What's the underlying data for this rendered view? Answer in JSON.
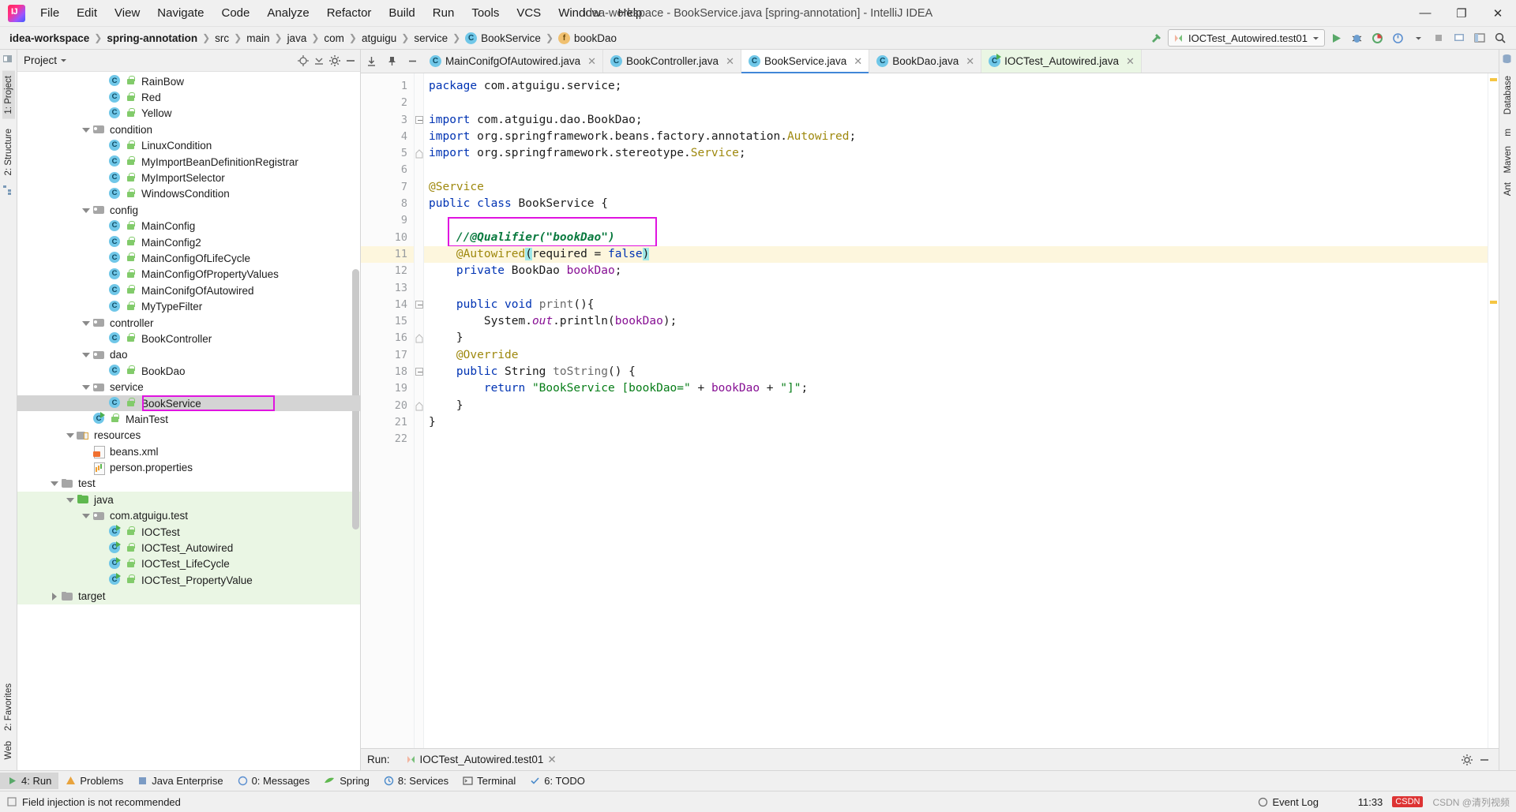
{
  "window": {
    "title": "idea-workspace - BookService.java [spring-annotation] - IntelliJ IDEA",
    "minimize": "—",
    "maximize": "❐",
    "close": "✕"
  },
  "menu": [
    {
      "label": "File"
    },
    {
      "label": "Edit"
    },
    {
      "label": "View"
    },
    {
      "label": "Navigate"
    },
    {
      "label": "Code"
    },
    {
      "label": "Analyze"
    },
    {
      "label": "Refactor"
    },
    {
      "label": "Build"
    },
    {
      "label": "Run"
    },
    {
      "label": "Tools"
    },
    {
      "label": "VCS"
    },
    {
      "label": "Window"
    },
    {
      "label": "Help"
    }
  ],
  "breadcrumb": [
    {
      "label": "idea-workspace",
      "bold": true
    },
    {
      "label": "spring-annotation",
      "bold": true
    },
    {
      "label": "src"
    },
    {
      "label": "main"
    },
    {
      "label": "java"
    },
    {
      "label": "com"
    },
    {
      "label": "atguigu"
    },
    {
      "label": "service"
    },
    {
      "label": "BookService",
      "icon": "class-icon"
    },
    {
      "label": "bookDao",
      "icon": "field-icon"
    }
  ],
  "toolbar": {
    "run_config": "IOCTest_Autowired.test01",
    "buttons": [
      "run-button",
      "debug-button",
      "coverage-button",
      "profile-button",
      "stop-button",
      "layout-button",
      "settings-button",
      "search-button"
    ]
  },
  "project_panel": {
    "title": "Project",
    "tree": [
      {
        "depth": 4,
        "icon": "class",
        "label": "RainBow"
      },
      {
        "depth": 4,
        "icon": "class",
        "label": "Red"
      },
      {
        "depth": 4,
        "icon": "class",
        "label": "Yellow"
      },
      {
        "depth": 3,
        "icon": "package",
        "label": "condition",
        "twist": "down"
      },
      {
        "depth": 4,
        "icon": "class",
        "label": "LinuxCondition"
      },
      {
        "depth": 4,
        "icon": "class",
        "label": "MyImportBeanDefinitionRegistrar"
      },
      {
        "depth": 4,
        "icon": "class",
        "label": "MyImportSelector"
      },
      {
        "depth": 4,
        "icon": "class",
        "label": "WindowsCondition"
      },
      {
        "depth": 3,
        "icon": "package",
        "label": "config",
        "twist": "down"
      },
      {
        "depth": 4,
        "icon": "class",
        "label": "MainConfig"
      },
      {
        "depth": 4,
        "icon": "class",
        "label": "MainConfig2"
      },
      {
        "depth": 4,
        "icon": "class",
        "label": "MainConfigOfLifeCycle"
      },
      {
        "depth": 4,
        "icon": "class",
        "label": "MainConfigOfPropertyValues"
      },
      {
        "depth": 4,
        "icon": "class",
        "label": "MainConifgOfAutowired"
      },
      {
        "depth": 4,
        "icon": "class",
        "label": "MyTypeFilter"
      },
      {
        "depth": 3,
        "icon": "package",
        "label": "controller",
        "twist": "down"
      },
      {
        "depth": 4,
        "icon": "class",
        "label": "BookController"
      },
      {
        "depth": 3,
        "icon": "package",
        "label": "dao",
        "twist": "down"
      },
      {
        "depth": 4,
        "icon": "class",
        "label": "BookDao"
      },
      {
        "depth": 3,
        "icon": "package",
        "label": "service",
        "twist": "down"
      },
      {
        "depth": 4,
        "icon": "class",
        "label": "BookService",
        "selected": true,
        "boxed": true
      },
      {
        "depth": 3,
        "icon": "class-runnable",
        "label": "MainTest"
      },
      {
        "depth": 2,
        "icon": "resources",
        "label": "resources",
        "twist": "down"
      },
      {
        "depth": 3,
        "icon": "xml",
        "label": "beans.xml"
      },
      {
        "depth": 3,
        "icon": "properties",
        "label": "person.properties"
      },
      {
        "depth": 1,
        "icon": "folder",
        "label": "test",
        "twist": "down"
      },
      {
        "depth": 2,
        "icon": "source-test",
        "label": "java",
        "twist": "down",
        "test": true
      },
      {
        "depth": 3,
        "icon": "package",
        "label": "com.atguigu.test",
        "twist": "down",
        "test": true
      },
      {
        "depth": 4,
        "icon": "class-runnable",
        "label": "IOCTest",
        "test": true
      },
      {
        "depth": 4,
        "icon": "class-runnable",
        "label": "IOCTest_Autowired",
        "test": true
      },
      {
        "depth": 4,
        "icon": "class-runnable",
        "label": "IOCTest_LifeCycle",
        "test": true
      },
      {
        "depth": 4,
        "icon": "class-runnable",
        "label": "IOCTest_PropertyValue",
        "test": true
      },
      {
        "depth": 1,
        "icon": "folder",
        "label": "target",
        "twist": "right",
        "test": true
      }
    ]
  },
  "editor": {
    "tabs": [
      {
        "label": "MainConifgOfAutowired.java",
        "icon": "class",
        "active": false
      },
      {
        "label": "BookController.java",
        "icon": "class",
        "active": false
      },
      {
        "label": "BookService.java",
        "icon": "class",
        "active": true
      },
      {
        "label": "BookDao.java",
        "icon": "class",
        "active": false
      },
      {
        "label": "IOCTest_Autowired.java",
        "icon": "class-runnable",
        "active": false,
        "test": true
      }
    ],
    "current_line": 11,
    "lines": [
      {
        "n": 1,
        "tokens": [
          {
            "t": "package ",
            "c": "kw"
          },
          {
            "t": "com.atguigu.service;",
            "c": ""
          }
        ]
      },
      {
        "n": 2,
        "tokens": []
      },
      {
        "n": 3,
        "fold": "start",
        "tokens": [
          {
            "t": "import ",
            "c": "kw"
          },
          {
            "t": "com.atguigu.dao.BookDao;",
            "c": ""
          }
        ]
      },
      {
        "n": 4,
        "tokens": [
          {
            "t": "import ",
            "c": "kw"
          },
          {
            "t": "org.springframework.beans.factory.annotation.",
            "c": ""
          },
          {
            "t": "Autowired",
            "c": "ann"
          },
          {
            "t": ";",
            "c": ""
          }
        ]
      },
      {
        "n": 5,
        "fold": "end",
        "tokens": [
          {
            "t": "import ",
            "c": "kw"
          },
          {
            "t": "org.springframework.stereotype.",
            "c": ""
          },
          {
            "t": "Service",
            "c": "ann"
          },
          {
            "t": ";",
            "c": ""
          }
        ]
      },
      {
        "n": 6,
        "tokens": []
      },
      {
        "n": 7,
        "tokens": [
          {
            "t": "@Service",
            "c": "ann"
          }
        ]
      },
      {
        "n": 8,
        "tokens": [
          {
            "t": "public class ",
            "c": "kw"
          },
          {
            "t": "BookService {",
            "c": ""
          }
        ]
      },
      {
        "n": 9,
        "tokens": []
      },
      {
        "n": 10,
        "tokens": [
          {
            "t": "    //@Qualifier(\"bookDao\")",
            "c": "cmtb"
          }
        ],
        "boxed": true
      },
      {
        "n": 11,
        "bulb": true,
        "current": true,
        "tokens": [
          {
            "t": "    ",
            "c": ""
          },
          {
            "t": "@Autowired",
            "c": "ann"
          },
          {
            "t": "(",
            "c": "hl"
          },
          {
            "t": "required = ",
            "c": ""
          },
          {
            "t": "false",
            "c": "kw"
          },
          {
            "t": ")",
            "c": "hl"
          }
        ]
      },
      {
        "n": 12,
        "tokens": [
          {
            "t": "    ",
            "c": ""
          },
          {
            "t": "private ",
            "c": "kw"
          },
          {
            "t": "BookDao ",
            "c": ""
          },
          {
            "t": "bookDao",
            "c": "fld"
          },
          {
            "t": ";",
            "c": ""
          }
        ]
      },
      {
        "n": 13,
        "tokens": []
      },
      {
        "n": 14,
        "fold": "start",
        "tokens": [
          {
            "t": "    ",
            "c": ""
          },
          {
            "t": "public void ",
            "c": "kw"
          },
          {
            "t": "print",
            "c": "mth"
          },
          {
            "t": "(){",
            "c": ""
          }
        ]
      },
      {
        "n": 15,
        "tokens": [
          {
            "t": "        System.",
            "c": ""
          },
          {
            "t": "out",
            "c": "stat"
          },
          {
            "t": ".println(",
            "c": ""
          },
          {
            "t": "bookDao",
            "c": "fld"
          },
          {
            "t": ");",
            "c": ""
          }
        ]
      },
      {
        "n": 16,
        "fold": "end",
        "tokens": [
          {
            "t": "    }",
            "c": ""
          }
        ]
      },
      {
        "n": 17,
        "tokens": [
          {
            "t": "    ",
            "c": ""
          },
          {
            "t": "@Override",
            "c": "ann"
          }
        ]
      },
      {
        "n": 18,
        "gmark": "override",
        "fold": "start",
        "tokens": [
          {
            "t": "    ",
            "c": ""
          },
          {
            "t": "public ",
            "c": "kw"
          },
          {
            "t": "String ",
            "c": ""
          },
          {
            "t": "toString",
            "c": "mth"
          },
          {
            "t": "() {",
            "c": ""
          }
        ]
      },
      {
        "n": 19,
        "tokens": [
          {
            "t": "        ",
            "c": ""
          },
          {
            "t": "return ",
            "c": "kw"
          },
          {
            "t": "\"BookService [bookDao=\"",
            "c": "str"
          },
          {
            "t": " + ",
            "c": ""
          },
          {
            "t": "bookDao",
            "c": "fld"
          },
          {
            "t": " + ",
            "c": ""
          },
          {
            "t": "\"]\"",
            "c": "str"
          },
          {
            "t": ";",
            "c": ""
          }
        ]
      },
      {
        "n": 20,
        "fold": "end",
        "tokens": [
          {
            "t": "    }",
            "c": ""
          }
        ]
      },
      {
        "n": 21,
        "tokens": [
          {
            "t": "}",
            "c": ""
          }
        ]
      },
      {
        "n": 22,
        "tokens": []
      }
    ]
  },
  "run_panel": {
    "label": "Run:",
    "tab_label": "IOCTest_Autowired.test01"
  },
  "tool_windows": [
    {
      "label": "4: Run",
      "icon": "run-icon",
      "selected": true
    },
    {
      "label": "Problems",
      "icon": "problems-icon"
    },
    {
      "label": "Java Enterprise",
      "icon": "java-ee-icon"
    },
    {
      "label": "0: Messages",
      "icon": "messages-icon"
    },
    {
      "label": "Spring",
      "icon": "spring-icon"
    },
    {
      "label": "8: Services",
      "icon": "services-icon"
    },
    {
      "label": "Terminal",
      "icon": "terminal-icon"
    },
    {
      "label": "6: TODO",
      "icon": "todo-icon"
    }
  ],
  "left_rail": [
    {
      "label": "1: Project",
      "selected": true
    },
    {
      "label": "2: Structure"
    },
    {
      "label": "2: Favorites"
    },
    {
      "label": "Web"
    }
  ],
  "right_rail": [
    {
      "label": "Database"
    },
    {
      "label": "m"
    },
    {
      "label": "Maven"
    },
    {
      "label": "Ant"
    }
  ],
  "status": {
    "message": "Field injection is not recommended",
    "time": "11:33",
    "event_log": "Event Log",
    "watermark": "CSDN @清列视频"
  },
  "colors": {
    "accent": "#4187d8",
    "highlight_box": "#e014e0",
    "test_bg": "#eaf6e4",
    "current_line": "#fdf6dd",
    "keyword": "#0033b3",
    "annotation": "#9e880d",
    "string": "#067d17",
    "comment_bold": "#0a7a3f",
    "field": "#871094"
  }
}
